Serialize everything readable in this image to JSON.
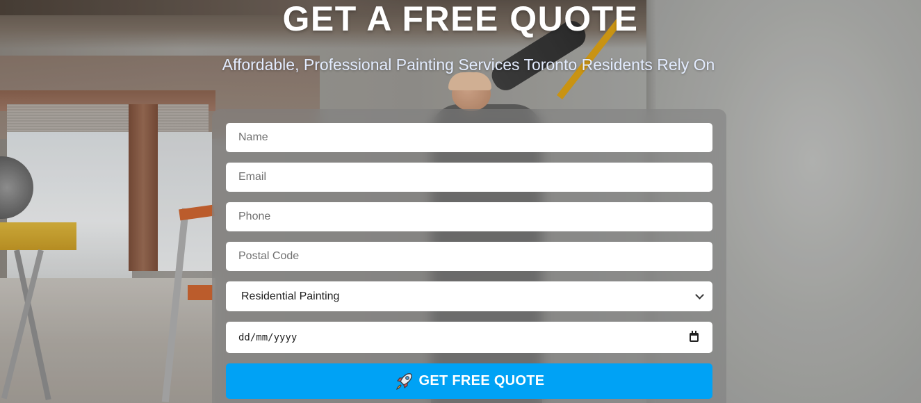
{
  "header": {
    "title": "GET A FREE QUOTE",
    "subtitle": "Affordable, Professional Painting Services Toronto Residents Rely On"
  },
  "form": {
    "name_placeholder": "Name",
    "email_placeholder": "Email",
    "phone_placeholder": "Phone",
    "postal_placeholder": "Postal Code",
    "service_selected": "Residential Painting",
    "date_placeholder": "dd/mm/yyyy",
    "submit_label": "GET FREE QUOTE",
    "submit_icon": "rocket-icon"
  },
  "colors": {
    "button_bg": "#00a2f5",
    "title": "#ffffff",
    "subtitle": "#e3ecff"
  }
}
